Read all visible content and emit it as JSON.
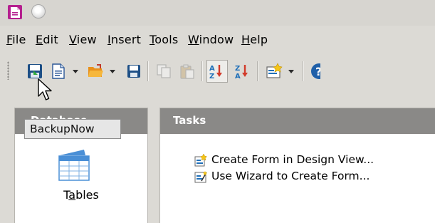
{
  "menu": [
    {
      "label": "File",
      "mnemonic": "F",
      "rest": "ile"
    },
    {
      "label": "Edit",
      "mnemonic": "E",
      "rest": "dit"
    },
    {
      "label": "View",
      "mnemonic": "V",
      "rest": "iew"
    },
    {
      "label": "Insert",
      "mnemonic": "I",
      "rest": "nsert"
    },
    {
      "label": "Tools",
      "mnemonic": "T",
      "rest": "ools"
    },
    {
      "label": "Window",
      "mnemonic": "W",
      "rest": "indow"
    },
    {
      "label": "Help",
      "mnemonic": "H",
      "rest": "elp"
    }
  ],
  "toolbar": {
    "icons": [
      "backup-now-icon",
      "new-document-icon",
      "open-folder-icon",
      "save-icon",
      "copy-icon",
      "paste-icon",
      "sort-ascending-icon",
      "sort-descending-icon",
      "form-wizard-icon",
      "help-icon"
    ],
    "active": "sort-ascending-icon"
  },
  "tooltip": {
    "text": "BackupNow"
  },
  "left_pane": {
    "header": "Database",
    "tables_label_pre": "T",
    "tables_label_mnemonic": "a",
    "tables_label_post": "bles"
  },
  "tasks": {
    "title": "Tasks",
    "items": [
      {
        "label": "Create Form in Design View...",
        "icon": "form-design-icon"
      },
      {
        "label": "Use Wizard to Create Form...",
        "icon": "form-wizard-icon"
      }
    ]
  },
  "colors": {
    "window_bg": "#dcdad5",
    "pane_header": "#8a8987",
    "accent_magenta": "#b5208f",
    "icon_blue": "#1f6fb8"
  }
}
